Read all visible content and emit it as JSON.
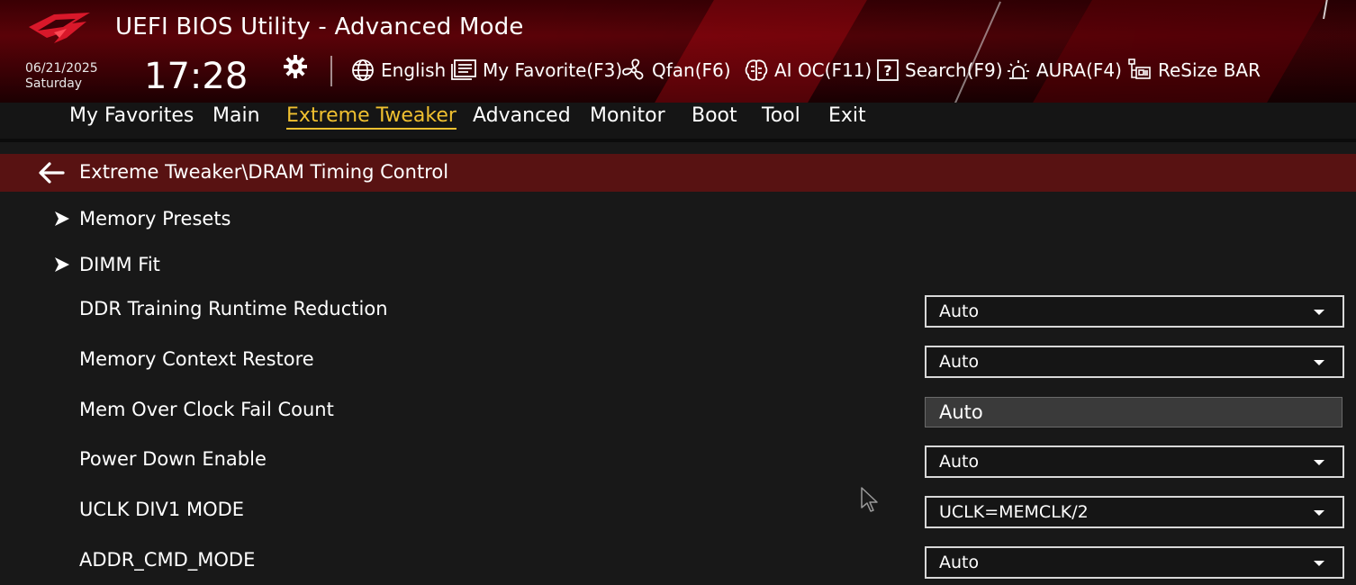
{
  "header": {
    "title": "UEFI BIOS Utility - Advanced Mode",
    "date": "06/21/2025",
    "weekday": "Saturday",
    "time": "17:28",
    "logo_icon": "rog-eye-logo",
    "accent_color": "#f0c030",
    "toolbar": [
      {
        "icon": "globe-icon",
        "label": "English"
      },
      {
        "icon": "favorite-list-icon",
        "label": "My Favorite(F3)"
      },
      {
        "icon": "fan-icon",
        "label": "Qfan(F6)"
      },
      {
        "icon": "ai-chip-icon",
        "label": "AI OC(F11)"
      },
      {
        "icon": "help-search-icon",
        "label": "Search(F9)"
      },
      {
        "icon": "aura-light-icon",
        "label": "AURA(F4)"
      },
      {
        "icon": "resize-bar-icon",
        "label": "ReSize BAR"
      }
    ]
  },
  "nav": {
    "items": [
      "My Favorites",
      "Main",
      "Extreme Tweaker",
      "Advanced",
      "Monitor",
      "Boot",
      "Tool",
      "Exit"
    ],
    "active": "Extreme Tweaker"
  },
  "breadcrumb": {
    "path": "Extreme Tweaker\\DRAM Timing Control"
  },
  "submenus": [
    {
      "label": "Memory Presets"
    },
    {
      "label": "DIMM Fit"
    }
  ],
  "settings": [
    {
      "label": "DDR Training Runtime Reduction",
      "value": "Auto",
      "control": "dropdown"
    },
    {
      "label": "Memory Context Restore",
      "value": "Auto",
      "control": "dropdown"
    },
    {
      "label": "Mem Over Clock Fail Count",
      "value": "Auto",
      "control": "input"
    },
    {
      "label": "Power Down Enable",
      "value": "Auto",
      "control": "dropdown"
    },
    {
      "label": "UCLK DIV1 MODE",
      "value": "UCLK=MEMCLK/2",
      "control": "dropdown"
    },
    {
      "label": "ADDR_CMD_MODE",
      "value": "Auto",
      "control": "dropdown"
    }
  ]
}
